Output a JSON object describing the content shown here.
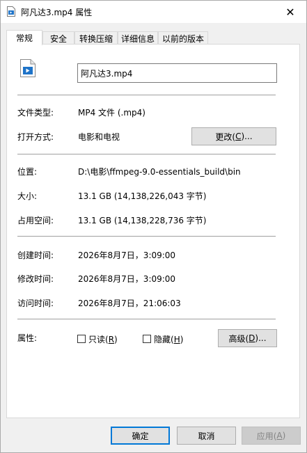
{
  "window": {
    "title": "阿凡达3.mp4 属性",
    "close_glyph": "✕"
  },
  "tabs": [
    {
      "label": "常规",
      "active": true
    },
    {
      "label": "安全",
      "active": false
    },
    {
      "label": "转换压缩",
      "active": false
    },
    {
      "label": "详细信息",
      "active": false
    },
    {
      "label": "以前的版本",
      "active": false
    }
  ],
  "general": {
    "file_name": "阿凡达3.mp4",
    "file_type_label": "文件类型:",
    "file_type_value": "MP4 文件 (.mp4)",
    "opens_with_label": "打开方式:",
    "opens_with_value": "电影和电视",
    "change_button": {
      "text": "更改(",
      "key": "C",
      "suffix": ")..."
    },
    "location_label": "位置:",
    "location_value": "D:\\电影\\ffmpeg-9.0-essentials_build\\bin",
    "size_label": "大小:",
    "size_value": "13.1 GB (14,138,226,043 字节)",
    "size_on_disk_label": "占用空间:",
    "size_on_disk_value": "13.1 GB (14,138,228,736 字节)",
    "created_label": "创建时间:",
    "created_value": "2026年8月7日，3:09:00",
    "modified_label": "修改时间:",
    "modified_value": "2026年8月7日，3:09:00",
    "accessed_label": "访问时间:",
    "accessed_value": "2026年8月7日，21:06:03",
    "attributes_label": "属性:",
    "readonly": {
      "text": "只读(",
      "key": "R",
      "suffix": ")",
      "checked": false
    },
    "hidden": {
      "text": "隐藏(",
      "key": "H",
      "suffix": ")",
      "checked": false
    },
    "advanced_button": {
      "text": "高级(",
      "key": "D",
      "suffix": ")..."
    }
  },
  "footer": {
    "ok_label": "确定",
    "cancel_label": "取消",
    "apply": {
      "text": "应用(",
      "key": "A",
      "suffix": ")"
    }
  },
  "colors": {
    "accent": "#0078d7",
    "panel_bg": "#ffffff",
    "dialog_bg": "#f0f0f0"
  },
  "icons": {
    "title": "video-file-icon",
    "file": "video-file-icon",
    "close": "close-icon"
  }
}
